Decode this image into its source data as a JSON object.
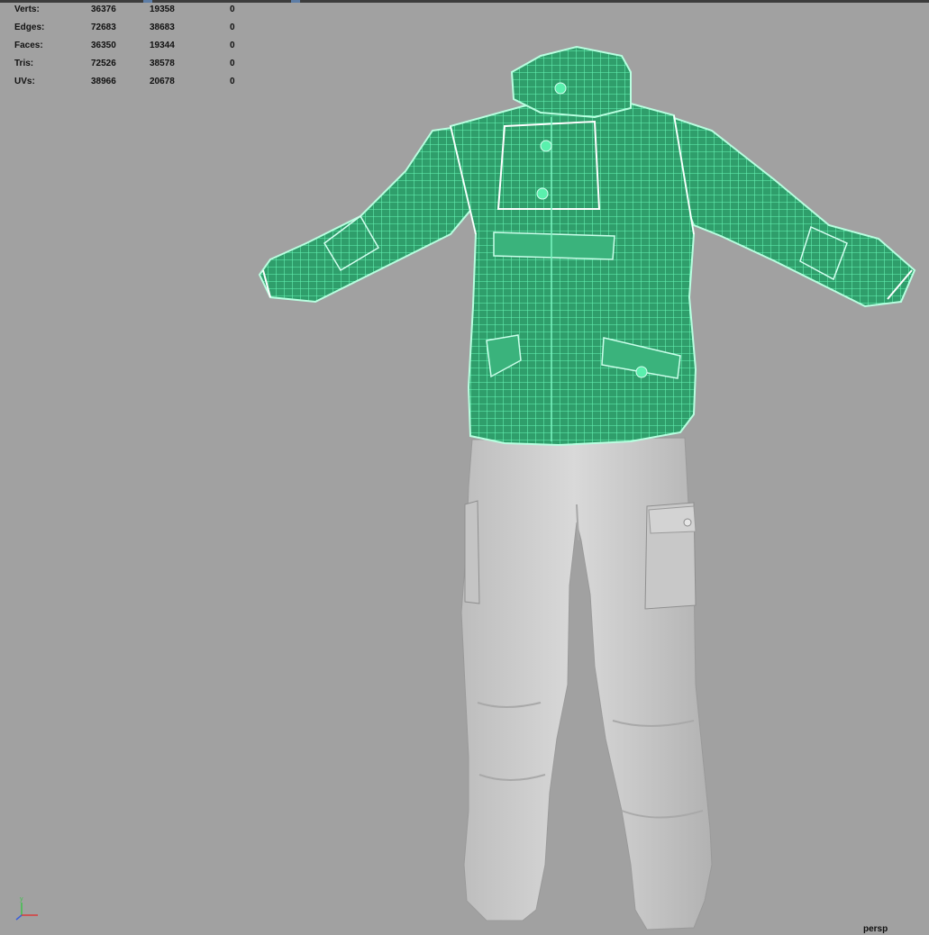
{
  "hud": {
    "rows": [
      {
        "label": "Verts:",
        "col1": "36376",
        "col2": "19358",
        "col3": "0"
      },
      {
        "label": "Edges:",
        "col1": "72683",
        "col2": "38683",
        "col3": "0"
      },
      {
        "label": "Faces:",
        "col1": "36350",
        "col2": "19344",
        "col3": "0"
      },
      {
        "label": "Tris:",
        "col1": "72526",
        "col2": "38578",
        "col3": "0"
      },
      {
        "label": "UVs:",
        "col1": "38966",
        "col2": "20678",
        "col3": "0"
      }
    ]
  },
  "viewport": {
    "camera_label": "persp",
    "background_color": "#a1a1a1",
    "selection_wire_color": "#45e8a0",
    "axis": {
      "y_label": "y",
      "x_color": "#d93a3a",
      "y_color": "#3cc24a",
      "z_color": "#3a5fd9"
    },
    "objects": [
      {
        "name": "jacket",
        "state": "selected-wireframe"
      },
      {
        "name": "pants",
        "state": "shaded"
      }
    ]
  }
}
